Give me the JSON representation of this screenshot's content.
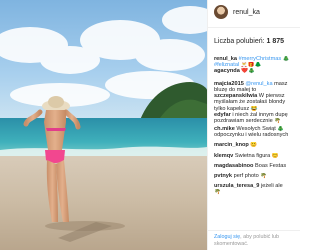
{
  "post": {
    "author": "renul_ka",
    "likes_label": "Liczba polubień:",
    "likes_count": "1 875"
  },
  "comments": [
    {
      "user": "renul_ka",
      "pre": " ",
      "tag": "#merryChristmas",
      "post": " 🎄"
    },
    {
      "user": "",
      "pre": "",
      "tag": "#feliznatal",
      "post": " 🎅🎁🌲"
    },
    {
      "user": "agacynda",
      "pre": " ❤️🎄",
      "tag": "",
      "post": ""
    },
    {
      "user": "majcia2015",
      "pre": " ",
      "tag": "@renul_ka",
      "post": " masz"
    },
    {
      "user": "",
      "pre": "",
      "tag": "",
      "post": "bluzę do małej to"
    },
    {
      "user": "szczepanskilwia",
      "pre": " W pierwsz",
      "tag": "",
      "post": ""
    },
    {
      "user": "",
      "pre": "",
      "tag": "",
      "post": "myślałam że zostałaś blondy"
    },
    {
      "user": "",
      "pre": "",
      "tag": "",
      "post": "tylko kapelusz 😂"
    },
    {
      "user": "edyfar",
      "pre": " i niech żal innym dupę",
      "tag": "",
      "post": ""
    },
    {
      "user": "",
      "pre": "",
      "tag": "",
      "post": "pozdrawiam serdecznie 🌴"
    },
    {
      "user": "ch.mike",
      "pre": " Wesołych Świąt 🎄",
      "tag": "",
      "post": ""
    },
    {
      "user": "",
      "pre": "",
      "tag": "",
      "post": "odpoczynku i wielu radosnych"
    },
    {
      "user": "marcin_knop",
      "pre": " 😊",
      "tag": "",
      "post": ""
    },
    {
      "user": "klemqv",
      "pre": " Świetna figura 😊",
      "tag": "",
      "post": ""
    },
    {
      "user": "magdasabinoo",
      "pre": " Boas Festas",
      "tag": "",
      "post": ""
    },
    {
      "user": "pvtnyk",
      "pre": " perf photo 🌴",
      "tag": "",
      "post": ""
    },
    {
      "user": "urszula_teresa_9",
      "pre": " jeżeli ale",
      "tag": "",
      "post": ""
    },
    {
      "user": "",
      "pre": "",
      "tag": "",
      "post": "🌴"
    }
  ],
  "footer": {
    "login_link": "Zaloguj się",
    "text": ", aby polubić lub skomentować."
  },
  "colors": {
    "link": "#3897f0",
    "text": "#262626",
    "muted": "#999999"
  }
}
